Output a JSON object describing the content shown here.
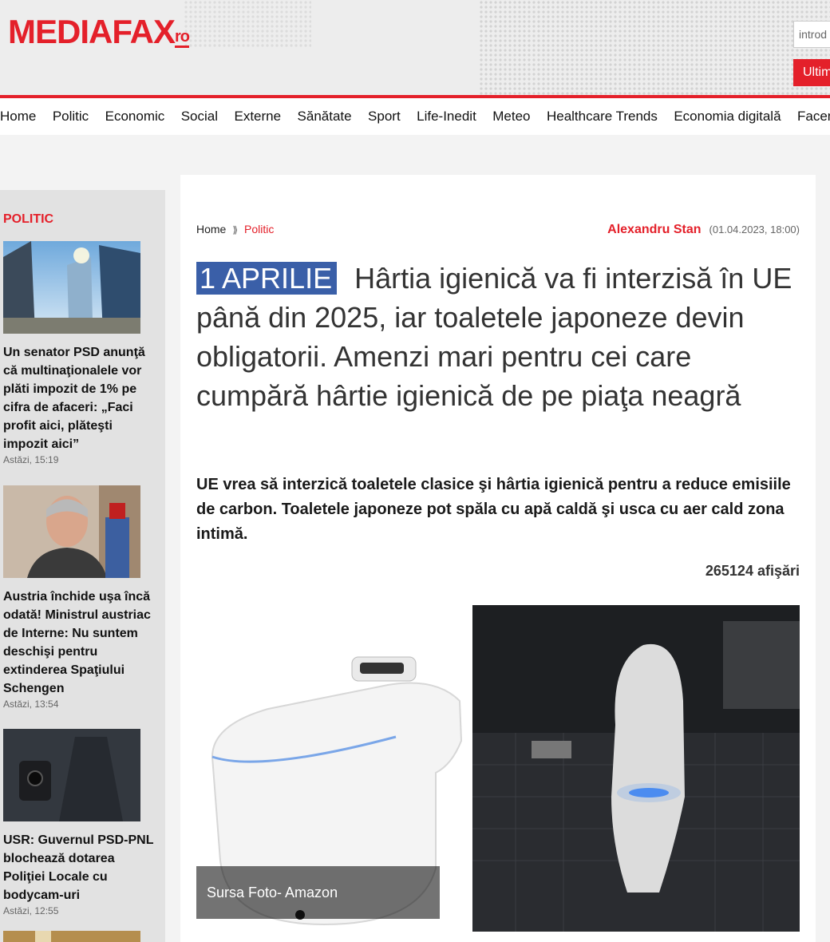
{
  "header": {
    "logo_text": "MEDIAFAX",
    "logo_tld": "ro",
    "search_placeholder": "introd",
    "latest_button": "Ultim"
  },
  "nav": {
    "items": [
      "Home",
      "Politic",
      "Economic",
      "Social",
      "Externe",
      "Sănătate",
      "Sport",
      "Life-Inedit",
      "Meteo",
      "Healthcare Trends",
      "Economia digitală",
      "Facem R"
    ]
  },
  "sidebar": {
    "title": "POLITIC",
    "items": [
      {
        "title": "Un senator PSD anunţă că multinaţionalele vor plăti impozit de 1% pe cifra de afaceri: „Faci profit aici, plăteşti impozit aici”",
        "date": "Astăzi, 15:19"
      },
      {
        "title": "Austria închide uşa încă odată! Ministrul austriac de Interne: Nu suntem deschişi pentru extinderea Spaţiului Schengen",
        "date": "Astăzi, 13:54"
      },
      {
        "title": "USR: Guvernul PSD-PNL blochează dotarea Poliţiei Locale cu bodycam-uri",
        "date": "Astăzi, 12:55"
      }
    ]
  },
  "article": {
    "breadcrumb": {
      "home": "Home",
      "category": "Politic"
    },
    "author": "Alexandru Stan",
    "date": "(01.04.2023, 18:00)",
    "tag": "1 APRILIE",
    "title": "Hârtia igienică va fi interzisă în UE până din 2025, iar toaletele japoneze devin obligatorii. Amenzi mari pentru cei care cumpără hârtie igienică de pe piaţa neagră",
    "lead": "UE vrea să interzică toaletele clasice şi hârtia igienică pentru a reduce emisiile de carbon. Toaletele japoneze pot spăla cu apă caldă şi usca cu aer cald zona intimă.",
    "views": "265124 afişări",
    "photo_caption": "Sursa Foto- Amazon"
  },
  "colors": {
    "brand_red": "#e4202a",
    "tag_blue": "#3a5fa8"
  }
}
